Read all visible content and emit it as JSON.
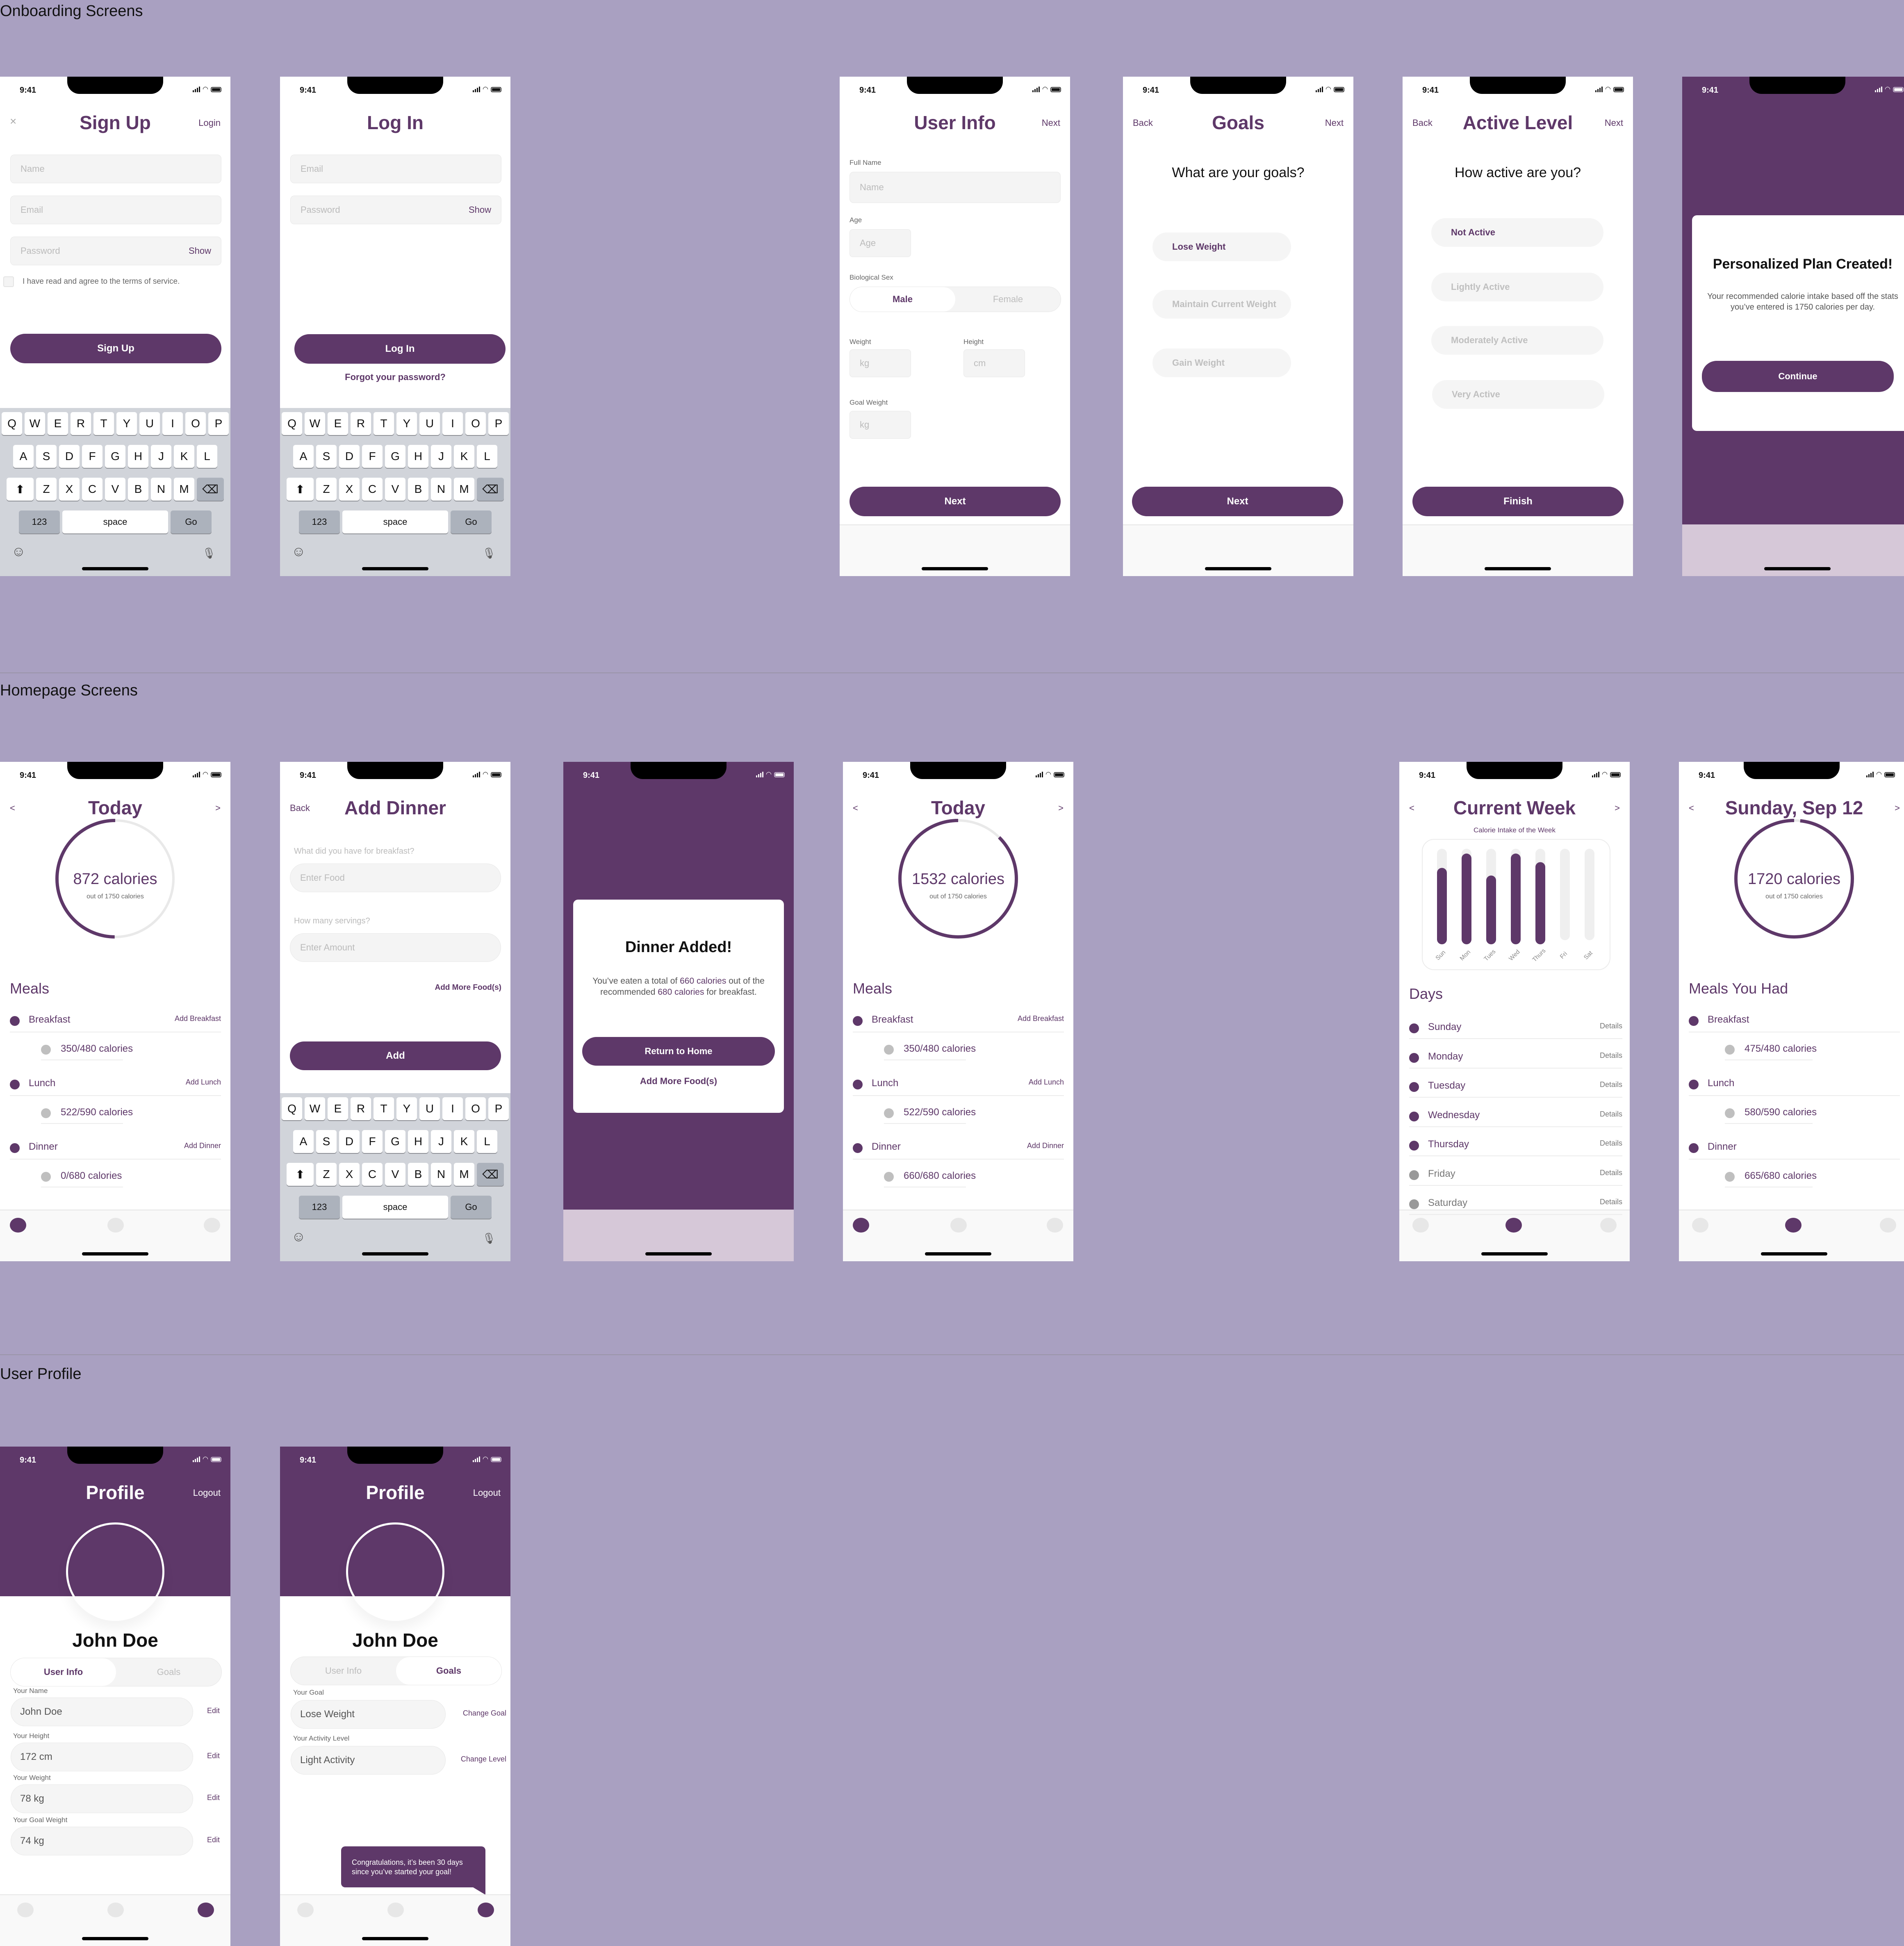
{
  "sections": {
    "onboarding": "Onboarding Screens",
    "homepage": "Homepage Screens",
    "profile": "User Profile"
  },
  "colors": {
    "brand": "#5e3869",
    "background": "#a9a0c1",
    "field": "#f4f4f4",
    "inactive": "#e7e7e7"
  },
  "status_bar": {
    "time": "9:41"
  },
  "keyboard": {
    "row1": [
      "Q",
      "W",
      "E",
      "R",
      "T",
      "Y",
      "U",
      "I",
      "O",
      "P"
    ],
    "row2": [
      "A",
      "S",
      "D",
      "F",
      "G",
      "H",
      "J",
      "K",
      "L"
    ],
    "row3": [
      "Z",
      "X",
      "C",
      "V",
      "B",
      "N",
      "M"
    ],
    "numbers": "123",
    "space": "space",
    "go": "Go"
  },
  "signup": {
    "title": "Sign Up",
    "close": "×",
    "login_link": "Login",
    "name_placeholder": "Name",
    "email_placeholder": "Email",
    "password_placeholder": "Password",
    "show": "Show",
    "terms": "I have read and agree to the terms of service.",
    "button": "Sign Up"
  },
  "login": {
    "title": "Log In",
    "email_placeholder": "Email",
    "password_placeholder": "Password",
    "show": "Show",
    "button": "Log In",
    "forgot": "Forgot your password?"
  },
  "user_info": {
    "title": "User Info",
    "next": "Next",
    "full_name_label": "Full Name",
    "name_placeholder": "Name",
    "age_label": "Age",
    "age_placeholder": "Age",
    "sex_label": "Biological Sex",
    "sex_options": [
      "Male",
      "Female"
    ],
    "sex_selected": "Male",
    "weight_label": "Weight",
    "weight_placeholder": "kg",
    "height_label": "Height",
    "height_placeholder": "cm",
    "goal_weight_label": "Goal Weight",
    "goal_weight_placeholder": "kg",
    "button": "Next"
  },
  "goals": {
    "title": "Goals",
    "back": "Back",
    "next": "Next",
    "question": "What are your goals?",
    "options": [
      "Lose Weight",
      "Maintain Current Weight",
      "Gain Weight"
    ],
    "selected": "Lose Weight",
    "button": "Next"
  },
  "active_level": {
    "title": "Active Level",
    "back": "Back",
    "next": "Next",
    "question": "How active are you?",
    "options": [
      "Not Active",
      "Lightly Active",
      "Moderately Active",
      "Very Active"
    ],
    "selected": "Not Active",
    "button": "Finish"
  },
  "plan_created": {
    "title": "Personalized Plan Created!",
    "body": "Your recommended calorie intake based off the stats you’ve entered is 1750 calories per day.",
    "button": "Continue"
  },
  "today_1": {
    "title": "Today",
    "prev": "<",
    "next": ">",
    "calories": "872 calories",
    "out_of": "out of 1750 calories",
    "consumed": 872,
    "target": 1750,
    "meals_heading": "Meals",
    "meals": [
      {
        "name": "Breakfast",
        "action": "Add Breakfast",
        "calories": "350/480 calories"
      },
      {
        "name": "Lunch",
        "action": "Add Lunch",
        "calories": "522/590 calories"
      },
      {
        "name": "Dinner",
        "action": "Add Dinner",
        "calories": "0/680 calories"
      }
    ]
  },
  "add_dinner": {
    "title": "Add Dinner",
    "back": "Back",
    "food_question": "What did you have for breakfast?",
    "food_placeholder": "Enter Food",
    "servings_question": "How many servings?",
    "servings_placeholder": "Enter Amount",
    "add_more": "Add More Food(s)",
    "button": "Add"
  },
  "dinner_added": {
    "title": "Dinner Added!",
    "body_pre": "You’ve eaten a total of ",
    "body_hl1": "660 calories",
    "body_mid": " out of the recommended ",
    "body_hl2": "680 calories",
    "body_post": " for breakfast.",
    "button": "Return to Home",
    "add_more": "Add More Food(s)"
  },
  "today_2": {
    "title": "Today",
    "prev": "<",
    "next": ">",
    "calories": "1532 calories",
    "out_of": "out of 1750 calories",
    "consumed": 1532,
    "target": 1750,
    "meals_heading": "Meals",
    "meals": [
      {
        "name": "Breakfast",
        "action": "Add Breakfast",
        "calories": "350/480 calories"
      },
      {
        "name": "Lunch",
        "action": "Add Lunch",
        "calories": "522/590 calories"
      },
      {
        "name": "Dinner",
        "action": "Add Dinner",
        "calories": "660/680 calories"
      }
    ]
  },
  "current_week": {
    "title": "Current Week",
    "prev": "<",
    "next": ">",
    "days_heading": "Days",
    "days": [
      {
        "name": "Sunday",
        "action": "Details",
        "logged": true
      },
      {
        "name": "Monday",
        "action": "Details",
        "logged": true
      },
      {
        "name": "Tuesday",
        "action": "Details",
        "logged": true
      },
      {
        "name": "Wednesday",
        "action": "Details",
        "logged": true
      },
      {
        "name": "Thursday",
        "action": "Details",
        "logged": true
      },
      {
        "name": "Friday",
        "action": "Details",
        "logged": false
      },
      {
        "name": "Saturday",
        "action": "Details",
        "logged": false
      }
    ]
  },
  "chart_data": {
    "type": "bar",
    "title": "Calorie Intake of the Week",
    "categories": [
      "Sun",
      "Mon",
      "Tues",
      "Wed",
      "Thurs",
      "Fri",
      "Sat"
    ],
    "values": [
      0.8,
      0.95,
      0.72,
      0.95,
      0.86,
      0,
      0
    ],
    "unit": "fraction of daily target",
    "xlabel": "",
    "ylabel": "",
    "ylim": [
      0,
      1
    ],
    "grid": false
  },
  "day_detail": {
    "title": "Sunday, Sep 12",
    "prev": "<",
    "next": ">",
    "calories": "1720 calories",
    "out_of": "out of 1750 calories",
    "consumed": 1720,
    "target": 1750,
    "meals_heading": "Meals You Had",
    "meals": [
      {
        "name": "Breakfast",
        "calories": "475/480 calories"
      },
      {
        "name": "Lunch",
        "calories": "580/590 calories"
      },
      {
        "name": "Dinner",
        "calories": "665/680 calories"
      }
    ]
  },
  "profile_info": {
    "title": "Profile",
    "logout": "Logout",
    "name": "John Doe",
    "tabs": [
      "User Info",
      "Goals"
    ],
    "active_tab": "User Info",
    "fields": [
      {
        "label": "Your Name",
        "value": "John Doe",
        "action": "Edit"
      },
      {
        "label": "Your Height",
        "value": "172 cm",
        "action": "Edit"
      },
      {
        "label": "Your Weight",
        "value": "78 kg",
        "action": "Edit"
      },
      {
        "label": "Your Goal Weight",
        "value": "74 kg",
        "action": "Edit"
      }
    ]
  },
  "profile_goals": {
    "title": "Profile",
    "logout": "Logout",
    "name": "John Doe",
    "tabs": [
      "User Info",
      "Goals"
    ],
    "active_tab": "Goals",
    "fields": [
      {
        "label": "Your Goal",
        "value": "Lose Weight",
        "action": "Change Goal"
      },
      {
        "label": "Your Activity Level",
        "value": "Light Activity",
        "action": "Change Level"
      }
    ],
    "toast": "Congratulations, it’s been 30 days since you’ve started your goal!"
  }
}
